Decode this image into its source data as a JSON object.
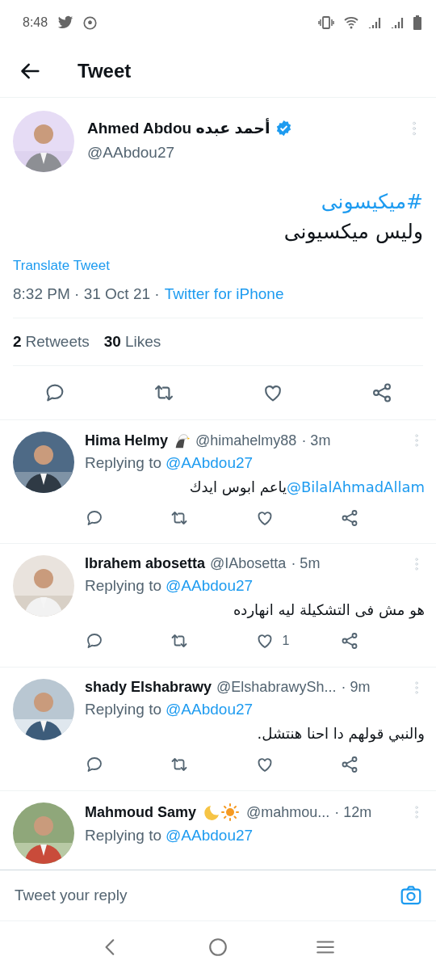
{
  "status_bar": {
    "time": "8:48"
  },
  "header": {
    "title": "Tweet"
  },
  "tweet": {
    "name": "Ahmed Abdou أحمد عبده",
    "verified": true,
    "handle": "@AAbdou27",
    "hashtag": "#ميكيسونى",
    "text": "وليس ميكسيونى",
    "translate": "Translate Tweet",
    "meta": "8:32 PM · 31 Oct 21 ·",
    "source": "Twitter for iPhone",
    "stats": [
      {
        "count": "2",
        "label": "Retweets"
      },
      {
        "count": "30",
        "label": "Likes"
      }
    ]
  },
  "replies": [
    {
      "kind": "eagle-badge",
      "name": "Hima Helmy",
      "handle": "@himahelmy88",
      "time": "· 3m",
      "replying_label": "Replying to",
      "replying_to": "@AAbdou27",
      "segments": [
        {
          "kind": "plain",
          "text": "ياعم ابوس ايدك "
        },
        {
          "kind": "mention",
          "text": "@BilalAhmadAllam"
        }
      ]
    },
    {
      "kind": "plain",
      "name": "Ibrahem abosetta",
      "handle": "@IAbosetta",
      "time": "· 5m",
      "replying_label": "Replying to",
      "replying_to": "@AAbdou27",
      "segments": [
        {
          "kind": "plain",
          "text": "هو مش فى التشكيلة ليه انهارده"
        }
      ],
      "like_count": "1"
    },
    {
      "kind": "plain",
      "name": "shady Elshabrawy",
      "handle": "@ElshabrawySh...",
      "time": "· 9m",
      "replying_label": "Replying to",
      "replying_to": "@AAbdou27",
      "segments": [
        {
          "kind": "plain",
          "text": "والنبي قولهم دا احنا هنتشل."
        }
      ]
    },
    {
      "kind": "moon-sun-badge",
      "name": "Mahmoud Samy",
      "handle": "@mahmou...",
      "time": "· 12m",
      "replying_label": "Replying to",
      "replying_to": "@AAbdou27"
    }
  ],
  "compose": {
    "placeholder": "Tweet your reply"
  }
}
